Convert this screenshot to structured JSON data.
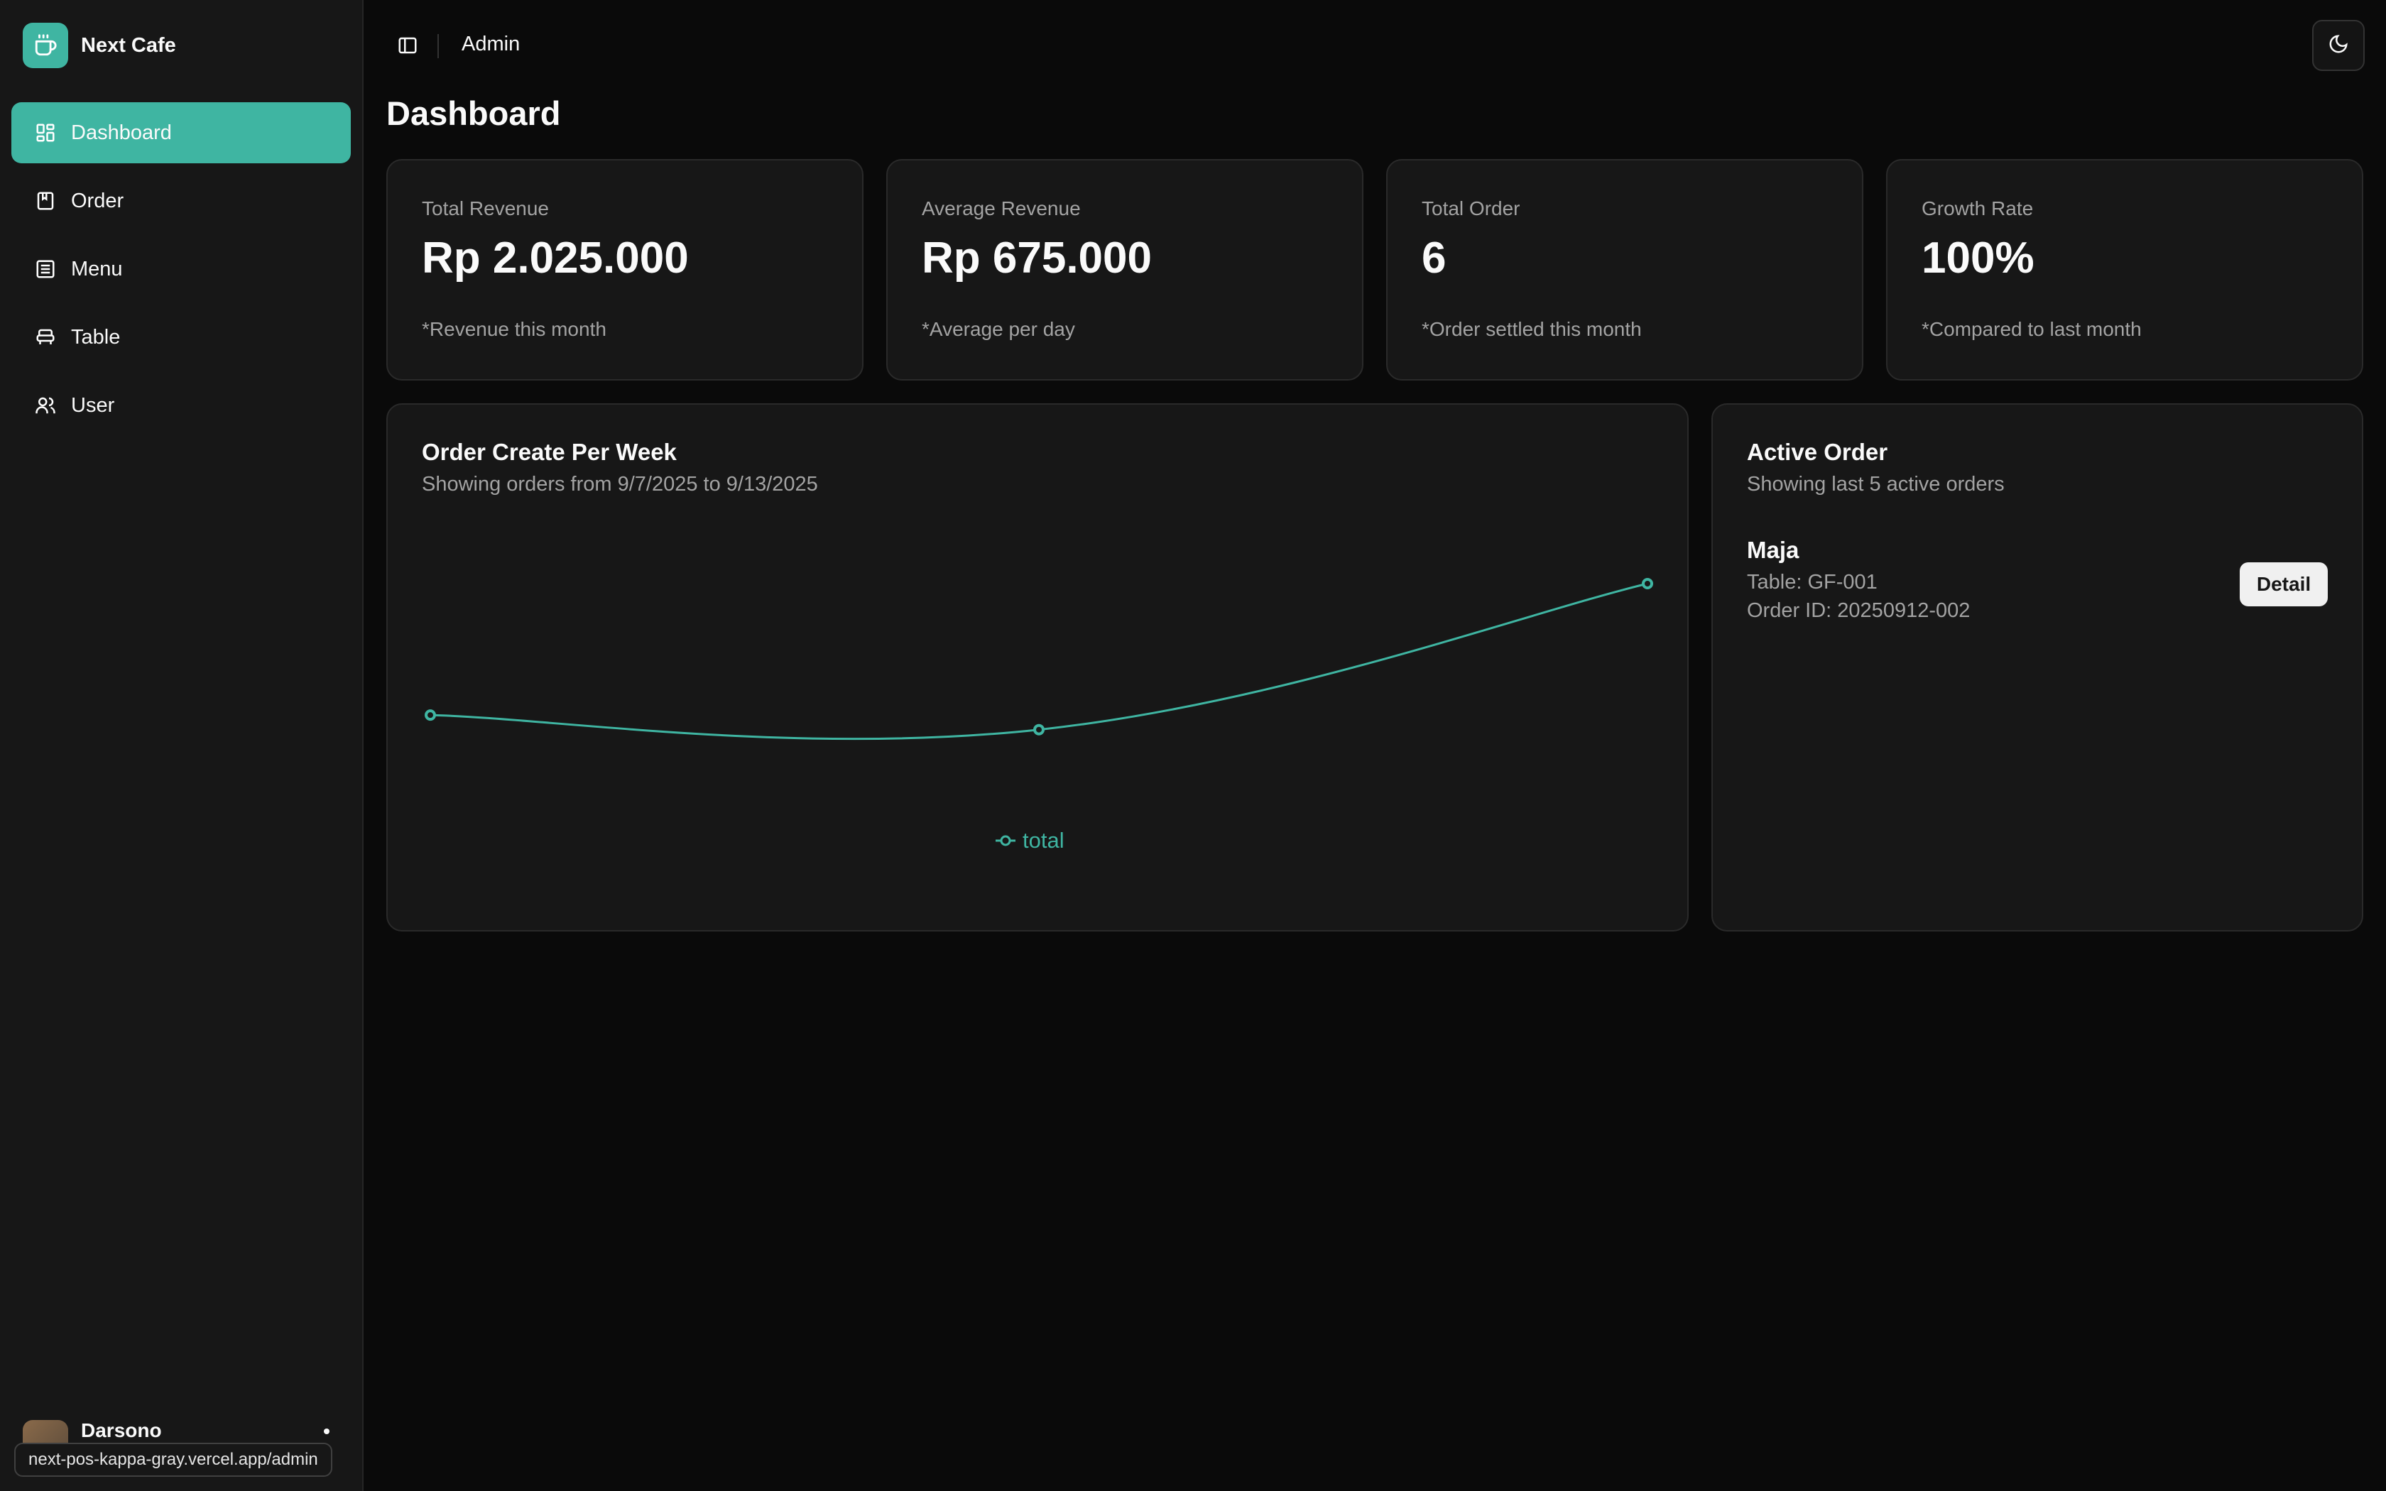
{
  "brand": {
    "name": "Next Cafe",
    "logo_icon": "coffee-icon"
  },
  "sidebar": {
    "items": [
      {
        "label": "Dashboard",
        "icon": "dashboard-icon",
        "active": true
      },
      {
        "label": "Order",
        "icon": "order-icon",
        "active": false
      },
      {
        "label": "Menu",
        "icon": "menu-list-icon",
        "active": false
      },
      {
        "label": "Table",
        "icon": "table-icon",
        "active": false
      },
      {
        "label": "User",
        "icon": "users-icon",
        "active": false
      }
    ],
    "user": {
      "name": "Darsono"
    }
  },
  "status_url": "next-pos-kappa-gray.vercel.app/admin",
  "header": {
    "title": "Admin"
  },
  "page": {
    "title": "Dashboard"
  },
  "stats": [
    {
      "label": "Total Revenue",
      "value": "Rp 2.025.000",
      "note": "*Revenue this month"
    },
    {
      "label": "Average Revenue",
      "value": "Rp 675.000",
      "note": "*Average per day"
    },
    {
      "label": "Total Order",
      "value": "6",
      "note": "*Order settled this month"
    },
    {
      "label": "Growth Rate",
      "value": "100%",
      "note": "*Compared to last month"
    }
  ],
  "chart_card": {
    "title": "Order Create Per Week",
    "subtitle": "Showing orders from 9/7/2025 to 9/13/2025"
  },
  "chart_data": {
    "type": "line",
    "x": [
      "",
      "",
      ""
    ],
    "series": [
      {
        "name": "total",
        "values": [
          1,
          0.8,
          2.8
        ]
      }
    ],
    "ylim": [
      0,
      3.5
    ],
    "grid": false,
    "legend": "bottom",
    "color": "#3fb5a2"
  },
  "active_order": {
    "title": "Active Order",
    "subtitle": "Showing last 5 active orders",
    "orders": [
      {
        "name": "Maja",
        "table": "Table: GF-001",
        "order_id": "Order ID: 20250912-002",
        "button": "Detail"
      }
    ]
  },
  "colors": {
    "accent": "#3fb5a2",
    "background": "#0a0a0a",
    "card": "#171717"
  }
}
